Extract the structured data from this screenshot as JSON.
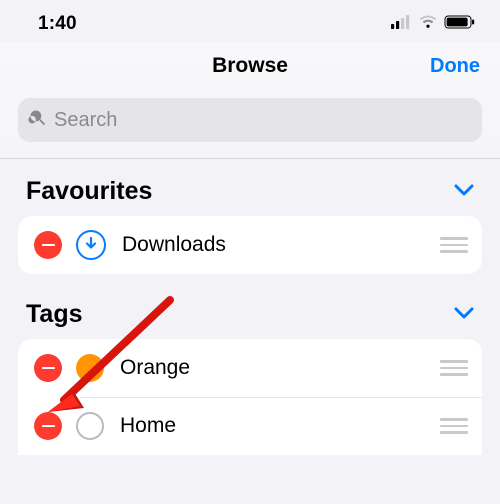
{
  "status": {
    "time": "1:40"
  },
  "nav": {
    "title": "Browse",
    "done": "Done"
  },
  "search": {
    "placeholder": "Search"
  },
  "sections": {
    "favourites": {
      "title": "Favourites",
      "items": [
        {
          "label": "Downloads",
          "icon": "download"
        }
      ]
    },
    "tags": {
      "title": "Tags",
      "items": [
        {
          "label": "Orange",
          "color": "#ff9500"
        },
        {
          "label": "Home",
          "color": null
        }
      ]
    }
  }
}
